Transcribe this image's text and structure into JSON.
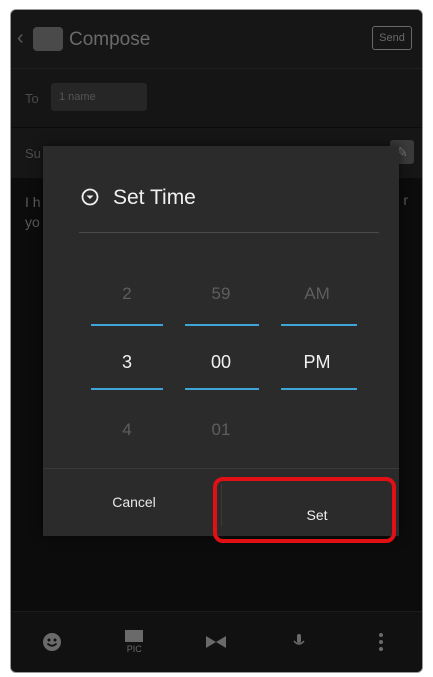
{
  "app": {
    "title": "Compose",
    "send_label": "Send"
  },
  "to_row": {
    "label": "To",
    "recipient": "1 name"
  },
  "subject": {
    "text": "Su"
  },
  "body": {
    "text_left": "I h\nyo",
    "text_right": "r"
  },
  "dialog": {
    "title": "Set Time",
    "columns": {
      "hour": {
        "prev": "2",
        "selected": "3",
        "next": "4"
      },
      "minute": {
        "prev": "59",
        "selected": "00",
        "next": "01"
      },
      "ampm": {
        "prev": "AM",
        "selected": "PM",
        "next": ""
      }
    },
    "cancel_label": "Cancel",
    "set_label": "Set"
  },
  "colors": {
    "accent": "#3ea6d8",
    "highlight": "#e01015"
  }
}
